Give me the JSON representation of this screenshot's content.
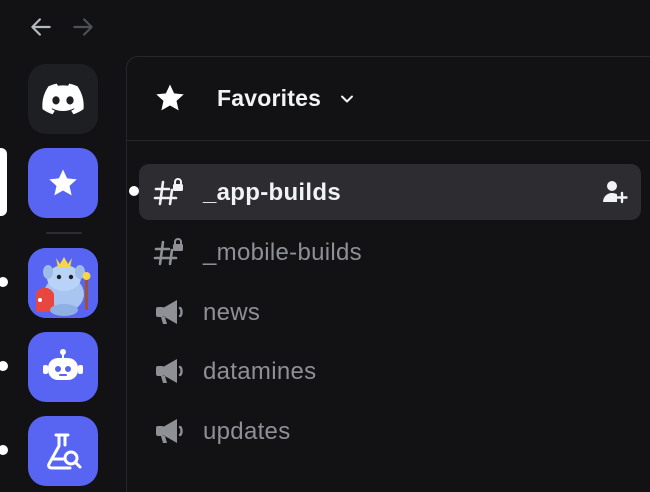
{
  "nav": {
    "back_icon": "arrow-left-icon",
    "forward_icon": "arrow-right-icon"
  },
  "rail": {
    "servers": [
      {
        "name": "discord-home",
        "icon": "discord-logo-icon",
        "bg": "#1e1f22"
      },
      {
        "name": "favorites",
        "icon": "star-icon",
        "bg": "#5865f2",
        "selected": true
      },
      {
        "name": "wumpus-king-server",
        "icon": "wumpus-king-avatar",
        "bg": "#5865f2"
      },
      {
        "name": "robot-server",
        "icon": "robot-icon",
        "bg": "#5865f2"
      },
      {
        "name": "lab-server",
        "icon": "flask-search-icon",
        "bg": "#5865f2"
      }
    ]
  },
  "header": {
    "title": "Favorites",
    "icon": "star-icon",
    "dropdown_icon": "chevron-down-icon"
  },
  "channels": [
    {
      "label": "_app-builds",
      "icon": "hashtag-lock-icon",
      "active": true
    },
    {
      "label": "_mobile-builds",
      "icon": "hashtag-lock-icon",
      "active": false
    },
    {
      "label": "news",
      "icon": "megaphone-icon",
      "active": false
    },
    {
      "label": "datamines",
      "icon": "megaphone-icon",
      "active": false
    },
    {
      "label": "updates",
      "icon": "megaphone-icon",
      "active": false
    }
  ],
  "colors": {
    "background": "#121214",
    "blurple": "#5865f2",
    "active_row": "#2c2c31",
    "text_primary": "#f2f3f5",
    "text_muted": "#8e9096"
  }
}
